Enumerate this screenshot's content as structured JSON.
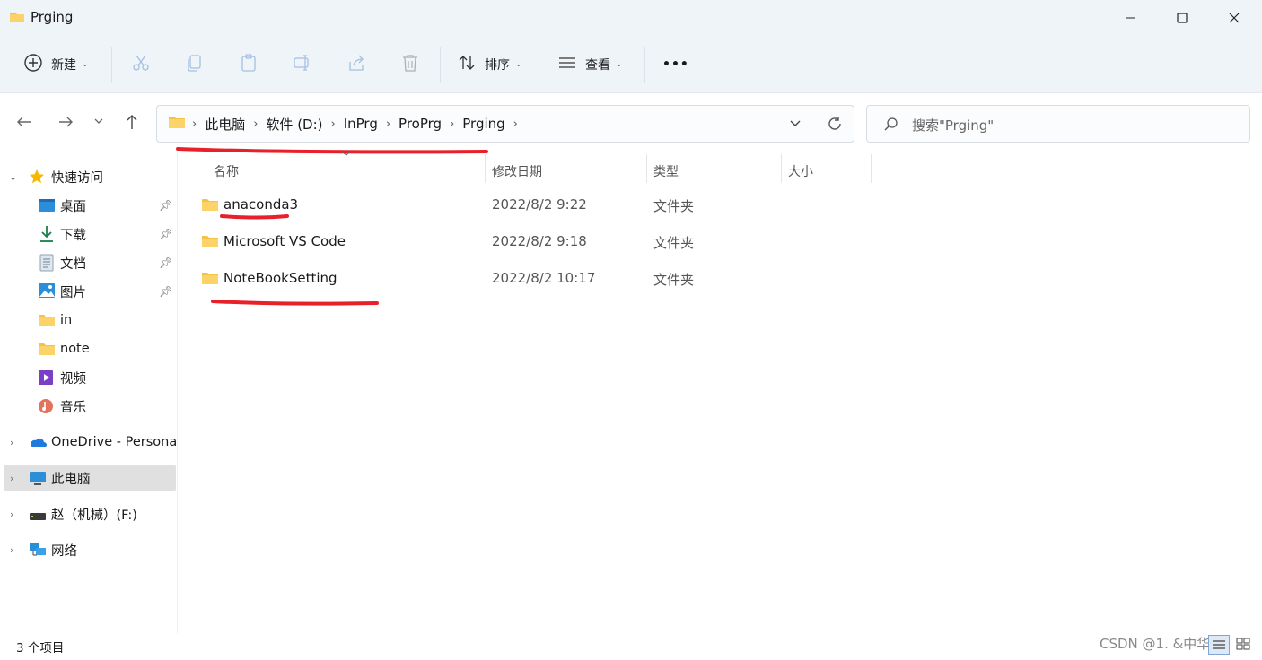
{
  "window": {
    "title": "Prging"
  },
  "toolbar": {
    "new_label": "新建",
    "sort_label": "排序",
    "view_label": "查看",
    "more_label": "•••"
  },
  "address": {
    "crumbs": [
      "此电脑",
      "软件 (D:)",
      "InPrg",
      "ProPrg",
      "Prging"
    ],
    "search_placeholder": "搜索\"Prging\""
  },
  "sidebar": {
    "quick_access": "快速访问",
    "items": [
      {
        "label": "桌面",
        "icon": "desktop-icon",
        "pinned": true
      },
      {
        "label": "下载",
        "icon": "download-icon",
        "pinned": true
      },
      {
        "label": "文档",
        "icon": "document-icon",
        "pinned": true
      },
      {
        "label": "图片",
        "icon": "pictures-icon",
        "pinned": true
      },
      {
        "label": "in",
        "icon": "folder-icon",
        "pinned": false
      },
      {
        "label": "note",
        "icon": "folder-icon",
        "pinned": false
      },
      {
        "label": "视频",
        "icon": "video-icon",
        "pinned": false
      },
      {
        "label": "音乐",
        "icon": "music-icon",
        "pinned": false
      }
    ],
    "onedrive": "OneDrive - Persona",
    "this_pc": "此电脑",
    "drive_f": "赵（机械）(F:)",
    "network": "网络"
  },
  "columns": {
    "name": "名称",
    "date": "修改日期",
    "type": "类型",
    "size": "大小"
  },
  "files": [
    {
      "name": "anaconda3",
      "date": "2022/8/2 9:22",
      "type": "文件夹"
    },
    {
      "name": "Microsoft VS Code",
      "date": "2022/8/2 9:18",
      "type": "文件夹"
    },
    {
      "name": "NoteBookSetting",
      "date": "2022/8/2 10:17",
      "type": "文件夹"
    }
  ],
  "status": {
    "item_count": "3 个项目"
  },
  "watermark": "CSDN @1. &中华她",
  "colors": {
    "accent": "#0067c0",
    "folder": "#f4c247",
    "annotation": "#e8202a"
  }
}
